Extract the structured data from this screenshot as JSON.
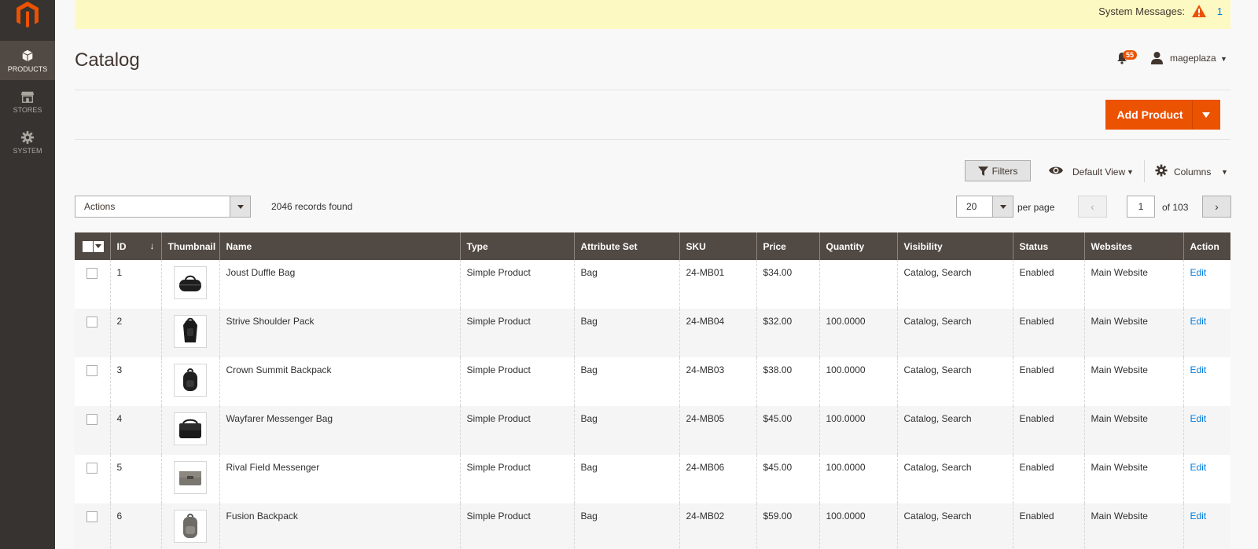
{
  "sidebar": {
    "items": [
      {
        "label": "PRODUCTS",
        "icon": "cube-icon",
        "active": true
      },
      {
        "label": "STORES",
        "icon": "storefront-icon",
        "active": false
      },
      {
        "label": "SYSTEM",
        "icon": "gear-icon",
        "active": false
      }
    ]
  },
  "system_messages": {
    "label": "System Messages:",
    "count": "1"
  },
  "header": {
    "title": "Catalog",
    "notifications_count": "55",
    "username": "mageplaza"
  },
  "page_actions": {
    "add_product_label": "Add Product"
  },
  "toolbar": {
    "filters_label": "Filters",
    "view_label": "Default View",
    "columns_label": "Columns",
    "actions_label": "Actions",
    "records_found": "2046 records found",
    "per_page_value": "20",
    "per_page_label": "per page",
    "current_page": "1",
    "total_pages_label": "of 103"
  },
  "grid": {
    "columns": [
      "ID",
      "Thumbnail",
      "Name",
      "Type",
      "Attribute Set",
      "SKU",
      "Price",
      "Quantity",
      "Visibility",
      "Status",
      "Websites",
      "Action"
    ],
    "rows": [
      {
        "id": "1",
        "name": "Joust Duffle Bag",
        "type": "Simple Product",
        "attribute_set": "Bag",
        "sku": "24-MB01",
        "price": "$34.00",
        "quantity": "",
        "visibility": "Catalog, Search",
        "status": "Enabled",
        "websites": "Main Website",
        "action": "Edit",
        "thumb": "duffle"
      },
      {
        "id": "2",
        "name": "Strive Shoulder Pack",
        "type": "Simple Product",
        "attribute_set": "Bag",
        "sku": "24-MB04",
        "price": "$32.00",
        "quantity": "100.0000",
        "visibility": "Catalog, Search",
        "status": "Enabled",
        "websites": "Main Website",
        "action": "Edit",
        "thumb": "shoulder"
      },
      {
        "id": "3",
        "name": "Crown Summit Backpack",
        "type": "Simple Product",
        "attribute_set": "Bag",
        "sku": "24-MB03",
        "price": "$38.00",
        "quantity": "100.0000",
        "visibility": "Catalog, Search",
        "status": "Enabled",
        "websites": "Main Website",
        "action": "Edit",
        "thumb": "backpack"
      },
      {
        "id": "4",
        "name": "Wayfarer Messenger Bag",
        "type": "Simple Product",
        "attribute_set": "Bag",
        "sku": "24-MB05",
        "price": "$45.00",
        "quantity": "100.0000",
        "visibility": "Catalog, Search",
        "status": "Enabled",
        "websites": "Main Website",
        "action": "Edit",
        "thumb": "messenger"
      },
      {
        "id": "5",
        "name": "Rival Field Messenger",
        "type": "Simple Product",
        "attribute_set": "Bag",
        "sku": "24-MB06",
        "price": "$45.00",
        "quantity": "100.0000",
        "visibility": "Catalog, Search",
        "status": "Enabled",
        "websites": "Main Website",
        "action": "Edit",
        "thumb": "field"
      },
      {
        "id": "6",
        "name": "Fusion Backpack",
        "type": "Simple Product",
        "attribute_set": "Bag",
        "sku": "24-MB02",
        "price": "$59.00",
        "quantity": "100.0000",
        "visibility": "Catalog, Search",
        "status": "Enabled",
        "websites": "Main Website",
        "action": "Edit",
        "thumb": "fusion"
      }
    ]
  },
  "colors": {
    "brand_orange": "#eb5202",
    "sidebar_bg": "#373330",
    "grid_header_bg": "#514943",
    "link_blue": "#007bdb",
    "message_bar_bg": "#fdf9c3"
  }
}
